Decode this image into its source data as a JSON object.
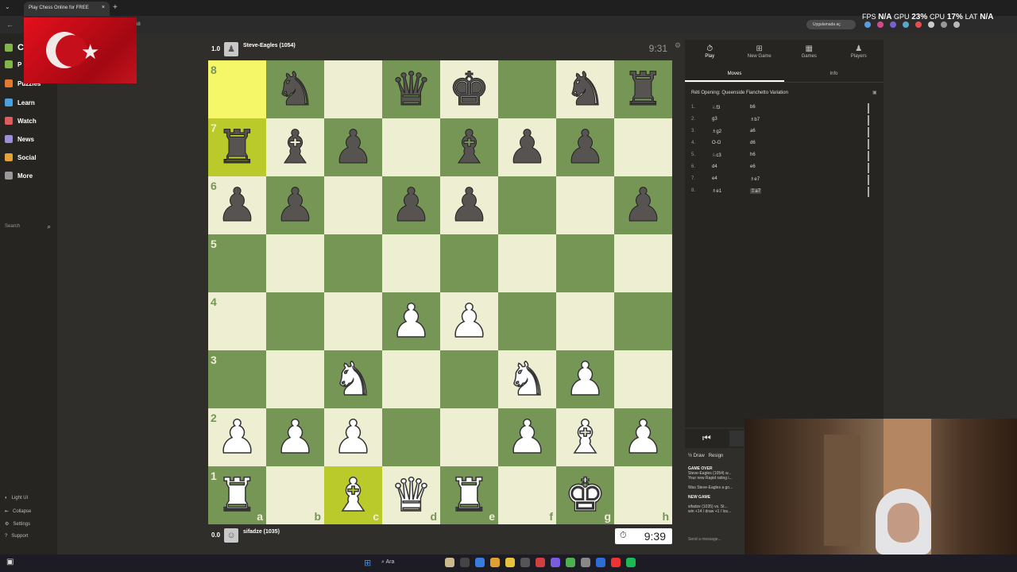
{
  "browser": {
    "tab_title": "Play Chess Online for FREE",
    "tab_close": "×",
    "new_tab": "+",
    "url_fragment": "68",
    "translate_pill": "Uygulamada aç"
  },
  "stats": {
    "fps": "FPS",
    "fps_val": "N/A",
    "gpu": "GPU",
    "gpu_val": "23%",
    "cpu": "CPU",
    "cpu_val": "17%",
    "lat": "LAT",
    "lat_val": "N/A"
  },
  "sidebar": {
    "logo": "Ch",
    "items": [
      {
        "label": "P",
        "color": "#81b64c"
      },
      {
        "label": "Puzzles",
        "color": "#e07a2f"
      },
      {
        "label": "Learn",
        "color": "#4aa3df"
      },
      {
        "label": "Watch",
        "color": "#e05b5b"
      },
      {
        "label": "News",
        "color": "#9c8fd6"
      },
      {
        "label": "Social",
        "color": "#e3a335"
      },
      {
        "label": "More",
        "color": "#999999"
      }
    ],
    "search_placeholder": "Search",
    "footer": [
      "Light UI",
      "Collapse",
      "Settings",
      "Support"
    ]
  },
  "game": {
    "top_player": {
      "score": "1.0",
      "name": "Steve-Eagles (1054)",
      "clock": "9:31"
    },
    "bottom_player": {
      "score": "0.0",
      "name": "sifadze (1035)",
      "clock": "9:39"
    },
    "board": [
      [
        "",
        "bN",
        "",
        "bQ",
        "bK",
        "",
        "bN",
        "bR"
      ],
      [
        "bR",
        "bB",
        "bP",
        "",
        "bB",
        "bP",
        "bP",
        ""
      ],
      [
        "bP",
        "bP",
        "",
        "bP",
        "bP",
        "",
        "",
        "bP"
      ],
      [
        "",
        "",
        "",
        "",
        "",
        "",
        "",
        ""
      ],
      [
        "",
        "",
        "",
        "wP",
        "wP",
        "",
        "",
        ""
      ],
      [
        "",
        "",
        "wN",
        "",
        "",
        "wN",
        "wP",
        ""
      ],
      [
        "wP",
        "wP",
        "wP",
        "",
        "",
        "wP",
        "wB",
        "wP"
      ],
      [
        "wR",
        "",
        "wB",
        "wQ",
        "wR",
        "",
        "wK",
        ""
      ]
    ],
    "ranks": [
      "8",
      "7",
      "6",
      "5",
      "4",
      "3",
      "2",
      "1"
    ],
    "files": [
      "a",
      "b",
      "c",
      "d",
      "e",
      "f",
      "g",
      "h"
    ],
    "highlights": [
      "a8",
      "a7"
    ],
    "highlights2": [
      "c1"
    ],
    "colors": {
      "light": "#eeeed2",
      "dark": "#769656",
      "highlight": "#f6f669",
      "highlight_dark": "#baca2b"
    }
  },
  "panel": {
    "tabs": [
      {
        "icon": "⏱",
        "label": "Play"
      },
      {
        "icon": "⊞",
        "label": "New Game"
      },
      {
        "icon": "▦",
        "label": "Games"
      },
      {
        "icon": "♟",
        "label": "Players"
      }
    ],
    "subtabs": [
      "Moves",
      "Info"
    ],
    "opening": "Réti Opening: Queenside Fianchetto Variation",
    "moves": [
      {
        "n": "1.",
        "w": "♘f3",
        "b": "b6"
      },
      {
        "n": "2.",
        "w": "g3",
        "b": "♗b7"
      },
      {
        "n": "3.",
        "w": "♗g2",
        "b": "a6"
      },
      {
        "n": "4.",
        "w": "O-O",
        "b": "d6"
      },
      {
        "n": "5.",
        "w": "♘c3",
        "b": "h6"
      },
      {
        "n": "6.",
        "w": "d4",
        "b": "e6"
      },
      {
        "n": "7.",
        "w": "e4",
        "b": "♗e7"
      },
      {
        "n": "8.",
        "w": "♗e1",
        "b": "♖a7"
      }
    ],
    "actions": {
      "draw": "½ Draw",
      "resign": "Resign"
    },
    "chat": [
      {
        "h": "GAME OVER",
        "t": "Steve-Eagles (1054) w..."
      },
      {
        "h": "",
        "t": "Your new Rapid rating i..."
      },
      {
        "h": "",
        "t": ""
      },
      {
        "h": "",
        "t": "Was Steve-Eagles a go..."
      },
      {
        "h": "",
        "t": ""
      },
      {
        "h": "NEW GAME",
        "t": ""
      },
      {
        "h": "",
        "t": "sifadze (1035) vs. St..."
      },
      {
        "h": "",
        "t": "win +14 / draw +1 / los..."
      }
    ],
    "send_placeholder": "Send a message..."
  },
  "taskbar": {
    "search": "Ara"
  }
}
